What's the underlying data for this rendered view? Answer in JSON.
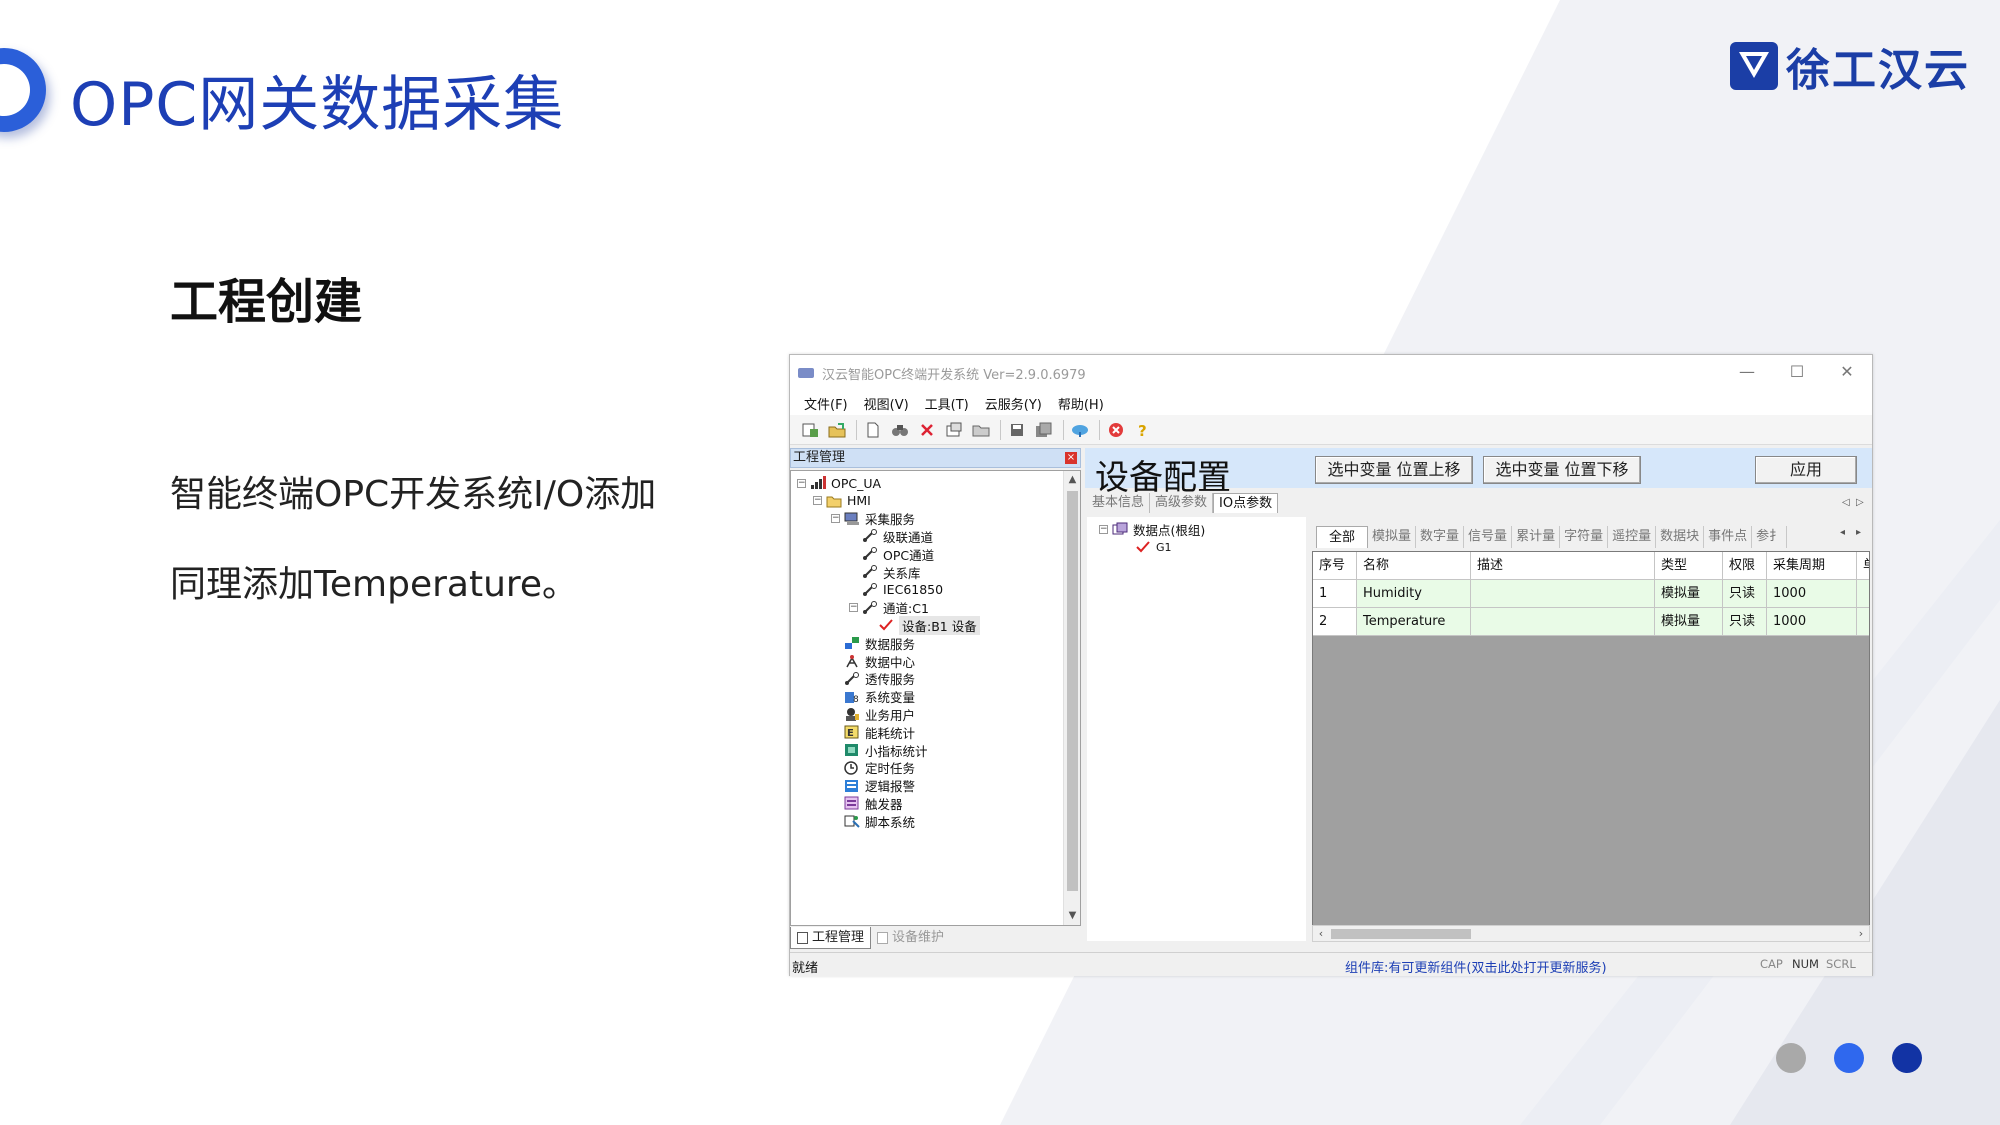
{
  "slide": {
    "title": "OPC网关数据采集",
    "logo_text": "徐工汉云",
    "section_title": "工程创建",
    "body_lines": [
      "智能终端OPC开发系统I/O添加",
      "同理添加Temperature。"
    ],
    "accent_color": "#1d3fb5",
    "dots": [
      {
        "name": "dot-gray",
        "color": "#a9a9a9"
      },
      {
        "name": "dot-blue",
        "color": "#2f68ee"
      },
      {
        "name": "dot-navy",
        "color": "#1233a4"
      }
    ]
  },
  "window": {
    "title": "汉云智能OPC终端开发系统 Ver=2.9.0.6979",
    "controls": {
      "minimize": "—",
      "maximize": "☐",
      "close": "✕"
    },
    "menu": [
      "文件(F)",
      "视图(V)",
      "工具(T)",
      "云服务(Y)",
      "帮助(H)"
    ],
    "toolbar_icons": [
      "new-project-icon",
      "open-project-icon",
      "new-file-icon",
      "find-icon",
      "delete-icon",
      "properties-icon",
      "open-folder-icon",
      "save-icon",
      "save-all-icon",
      "cloud-icon",
      "stop-icon",
      "help-icon"
    ],
    "left_pane": {
      "header": "工程管理",
      "tree": [
        {
          "label": "OPC_UA",
          "level": 0,
          "expander": "−",
          "icon": "signal-icon"
        },
        {
          "label": "HMI",
          "level": 1,
          "expander": "−",
          "icon": "folder-icon"
        },
        {
          "label": "采集服务",
          "level": 2,
          "expander": "−",
          "icon": "collect-service-icon"
        },
        {
          "label": "级联通道",
          "level": 3,
          "expander": "",
          "icon": "channel-icon"
        },
        {
          "label": "OPC通道",
          "level": 3,
          "expander": "",
          "icon": "channel-icon"
        },
        {
          "label": "关系库",
          "level": 3,
          "expander": "",
          "icon": "channel-icon"
        },
        {
          "label": "IEC61850",
          "level": 3,
          "expander": "",
          "icon": "channel-icon"
        },
        {
          "label": "通道:C1",
          "level": 3,
          "expander": "−",
          "icon": "channel-icon"
        },
        {
          "label": "设备:B1 设备",
          "level": 4,
          "expander": "",
          "icon": "check-icon",
          "selected": true
        },
        {
          "label": "数据服务",
          "level": 2,
          "expander": "",
          "icon": "data-service-icon"
        },
        {
          "label": "数据中心",
          "level": 2,
          "expander": "",
          "icon": "antenna-icon"
        },
        {
          "label": "透传服务",
          "level": 2,
          "expander": "",
          "icon": "channel-icon"
        },
        {
          "label": "系统变量",
          "level": 2,
          "expander": "",
          "icon": "variable-icon"
        },
        {
          "label": "业务用户",
          "level": 2,
          "expander": "",
          "icon": "user-icon"
        },
        {
          "label": "能耗统计",
          "level": 2,
          "expander": "",
          "icon": "energy-icon"
        },
        {
          "label": "小指标统计",
          "level": 2,
          "expander": "",
          "icon": "stats-icon"
        },
        {
          "label": "定时任务",
          "level": 2,
          "expander": "",
          "icon": "clock-icon"
        },
        {
          "label": "逻辑报警",
          "level": 2,
          "expander": "",
          "icon": "alarm-icon"
        },
        {
          "label": "触发器",
          "level": 2,
          "expander": "",
          "icon": "trigger-icon"
        },
        {
          "label": "脚本系统",
          "level": 2,
          "expander": "",
          "icon": "script-icon"
        }
      ],
      "tabs": [
        "工程管理",
        "设备维护"
      ]
    },
    "right_pane": {
      "title": "设备配置",
      "buttons": [
        "选中变量 位置上移",
        "选中变量 位置下移",
        "应用"
      ],
      "tabs": [
        "基本信息",
        "高级参数",
        "IO点参数"
      ],
      "point_tree": {
        "root": "数据点(根组)",
        "child": "G1"
      },
      "category_tabs": [
        "全部",
        "模拟量",
        "数字量",
        "信号量",
        "累计量",
        "字符量",
        "遥控量",
        "数据块",
        "事件点",
        "参扌"
      ],
      "columns": [
        "序号",
        "名称",
        "描述",
        "类型",
        "权限",
        "采集周期",
        "单"
      ],
      "rows": [
        {
          "index": "1",
          "name": "Humidity",
          "desc": "",
          "type": "模拟量",
          "perm": "只读",
          "period": "1000"
        },
        {
          "index": "2",
          "name": "Temperature",
          "desc": "",
          "type": "模拟量",
          "perm": "只读",
          "period": "1000"
        }
      ]
    },
    "status": {
      "left": "就绪",
      "middle": "组件库:有可更新组件(双击此处打开更新服务)",
      "indicators": [
        "CAP",
        "NUM",
        "SCRL"
      ]
    }
  }
}
